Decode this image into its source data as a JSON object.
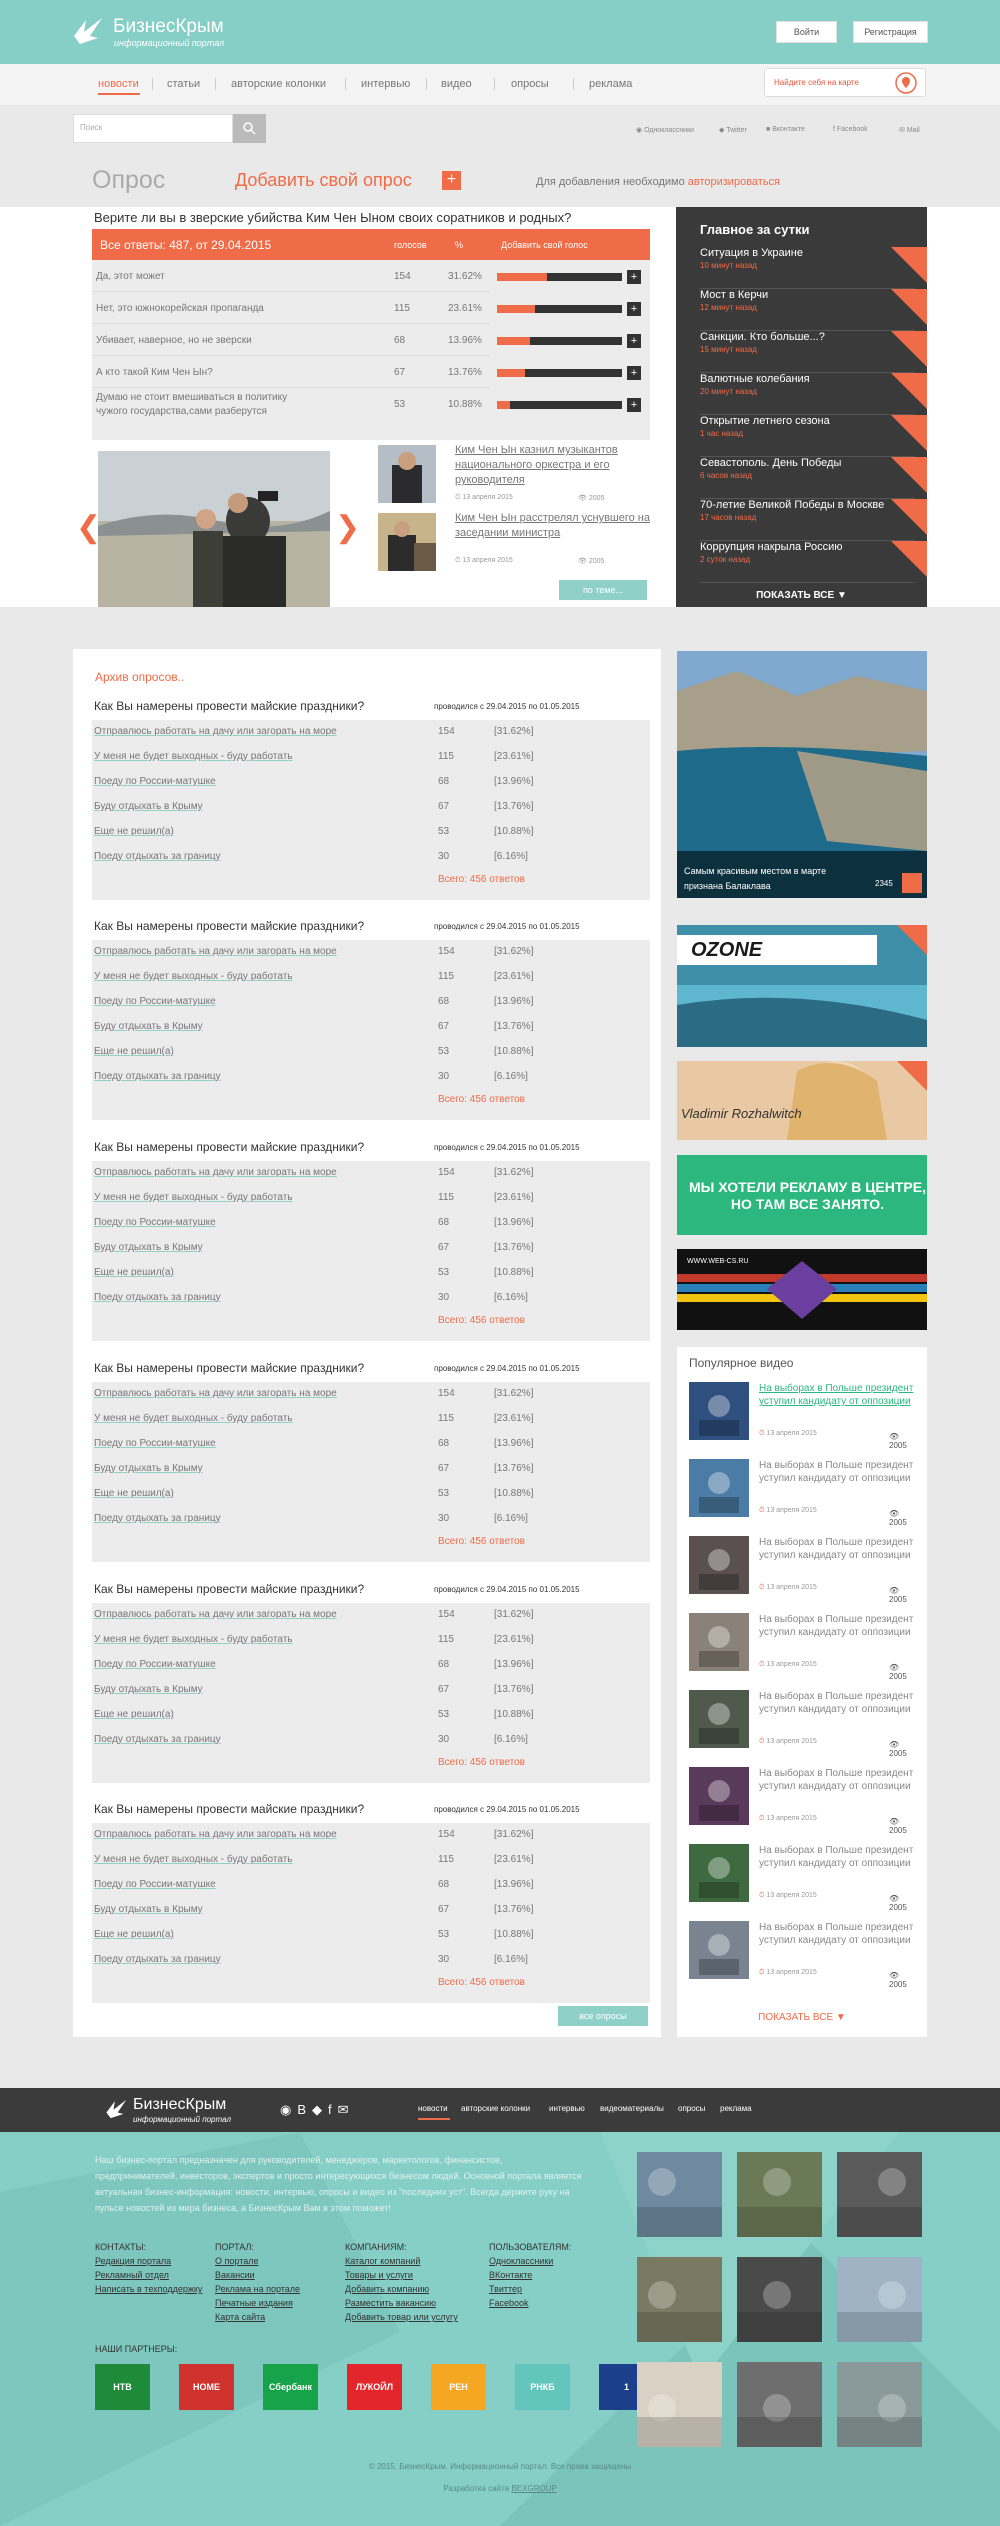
{
  "header": {
    "logo_title": "БизнесКрым",
    "logo_subtitle": "информационный портал",
    "login": "Войти",
    "register": "Регистрация"
  },
  "nav": {
    "items": [
      "новости",
      "статьи",
      "авторские колонки",
      "интервью",
      "видео",
      "опросы",
      "реклама"
    ],
    "find_on_map": "Найдите себя на карте"
  },
  "search": {
    "placeholder": "Поиск"
  },
  "social": [
    "Одноклассники",
    "Twitter",
    "Вконтакте",
    "Facebook",
    "Mail"
  ],
  "page": {
    "title": "Опрос",
    "add_poll": "Добавить свой опрос",
    "plus": "+",
    "note_prefix": "Для добавления необходимо ",
    "note_link": "авторизироваться"
  },
  "top_poll": {
    "question": "Верите ли вы в зверские убийства Ким Чен Ыном своих соратников и родных?",
    "all_answers": "Все ответы: 487, от 29.04.2015",
    "col_votes": "голосов",
    "col_pct": "%",
    "col_add": "Добавить свой голос",
    "rows": [
      {
        "text": "Да, этот может",
        "votes": "154",
        "pct": "31.62%",
        "frac": 0.4
      },
      {
        "text": "Нет, это южнокорейская пропаганда",
        "votes": "115",
        "pct": "23.61%",
        "frac": 0.3
      },
      {
        "text": "Убивает, наверное, но не зверски",
        "votes": "68",
        "pct": "13.96%",
        "frac": 0.26
      },
      {
        "text": "А кто такой Ким Чен Ын?",
        "votes": "67",
        "pct": "13.76%",
        "frac": 0.22
      },
      {
        "text": "Думаю не стоит вмешиваться в политику",
        "text2": "чужого государства,сами разберутся",
        "votes": "53",
        "pct": "10.88%",
        "frac": 0.1
      }
    ]
  },
  "top_news": {
    "title": "Главное за сутки",
    "show_all": "ПОКАЗАТЬ ВСЕ ▼",
    "items": [
      {
        "title": "Ситуация в Украине",
        "time": "10 минут назад"
      },
      {
        "title": "Мост в Керчи",
        "time": "12 минут назад"
      },
      {
        "title": "Санкции. Кто больше...?",
        "time": "15 минут назад"
      },
      {
        "title": "Валютные колебания",
        "time": "20 минут назад"
      },
      {
        "title": "Открытие летнего сезона",
        "time": "1 час назад"
      },
      {
        "title": "Севастополь. День Победы",
        "time": "6 часов назад"
      },
      {
        "title": "70-летие Великой Победы в Москве",
        "time": "17 часов назад"
      },
      {
        "title": "Коррупция накрыла Россию",
        "time": "2 суток назад"
      }
    ]
  },
  "side_news": [
    {
      "title": "Ким Чен Ын казнил музыкантов национального оркестра и его руководителя",
      "date": "13 апреля 2015",
      "views": "2005"
    },
    {
      "title": "Ким Чен Ын расстрелял уснувшего на заседании министра",
      "date": "13 апреля 2015",
      "views": "2005"
    }
  ],
  "more_themes": "по теме...",
  "archive": {
    "link": "Архив опросов..",
    "all_polls": "все опросы",
    "polls": [
      {
        "q": "Как Вы намерены провести майские праздники?",
        "dates": "проводился с 29.04.2015 по 01.05.2015",
        "total": "Всего: 456 ответов"
      },
      {
        "q": "Как Вы намерены провести майские праздники?",
        "dates": "проводился с 29.04.2015 по 01.05.2015",
        "total": "Всего: 456 ответов"
      },
      {
        "q": "Как Вы намерены провести майские праздники?",
        "dates": "проводился с 29.04.2015 по 01.05.2015",
        "total": "Всего: 456 ответов"
      },
      {
        "q": "Как Вы намерены провести майские праздники?",
        "dates": "проводился с 29.04.2015 по 01.05.2015",
        "total": "Всего: 456 ответов"
      },
      {
        "q": "Как Вы намерены провести майские праздники?",
        "dates": "проводился с 29.04.2015 по 01.05.2015",
        "total": "Всего: 456 ответов"
      },
      {
        "q": "Как Вы намерены провести майские праздники?",
        "dates": "проводился с 29.04.2015 по 01.05.2015",
        "total": "Всего: 456 ответов"
      }
    ],
    "answers": [
      {
        "t": "Отправлюсь работать на дачу или загорать на море",
        "n": "154",
        "p": "[31.62%]"
      },
      {
        "t": "У меня не будет выходных - буду работать",
        "n": "115",
        "p": "[23.61%]"
      },
      {
        "t": "Поеду по России-матушке",
        "n": "68",
        "p": "[13.96%]"
      },
      {
        "t": "Буду отдыхать в Крыму",
        "n": "67",
        "p": "[13.76%]"
      },
      {
        "t": "Еще не решил(а)",
        "n": "53",
        "p": "[10.88%]"
      },
      {
        "t": "Поеду отдыхать за границу",
        "n": "30",
        "p": "[6.16%]"
      }
    ]
  },
  "featured": {
    "caption1": "Самым красивым местом в марте",
    "caption2": "признана Балаклава",
    "views": "2345"
  },
  "ads": {
    "ozone": "OZONE",
    "photographer": "Vladimir Rozhalwitch",
    "text_ad": "МЫ ХОТЕЛИ РЕКЛАМУ В ЦЕНТРЕ, НО ТАМ ВСЕ ЗАНЯТО.",
    "web_url": "WWW.WEB-CS.RU"
  },
  "popular_video": {
    "title": "Популярное видео",
    "show_all": "ПОКАЗАТЬ ВСЕ ▼",
    "items": [
      {
        "t": "На выборах в Польше президент уступил кандидату от оппозиции",
        "d": "13 апреля 2015",
        "v": "2005"
      },
      {
        "t": "На выборах в Польше президент уступил кандидату от оппозиции",
        "d": "13 апреля 2015",
        "v": "2005"
      },
      {
        "t": "На выборах в Польше президент уступил кандидату от оппозиции",
        "d": "13 апреля 2015",
        "v": "2005"
      },
      {
        "t": "На выборах в Польше президент уступил кандидату от оппозиции",
        "d": "13 апреля 2015",
        "v": "2005"
      },
      {
        "t": "На выборах в Польше президент уступил кандидату от оппозиции",
        "d": "13 апреля 2015",
        "v": "2005"
      },
      {
        "t": "На выборах в Польше президент уступил кандидату от оппозиции",
        "d": "13 апреля 2015",
        "v": "2005"
      },
      {
        "t": "На выборах в Польше президент уступил кандидату от оппозиции",
        "d": "13 апреля 2015",
        "v": "2005"
      },
      {
        "t": "На выборах в Польше президент уступил кандидату от оппозиции",
        "d": "13 апреля 2015",
        "v": "2005"
      }
    ]
  },
  "footer": {
    "nav": [
      "новости",
      "авторские колонки",
      "интервью",
      "видеоматериалы",
      "опросы",
      "реклама"
    ],
    "description": "Наш бизнес-портал предназначен для руководителей, менеджеров, маркетологов, финансистов, предпринимателей, инвесторов, экспертов и просто интересующихся бизнесом людей. Основной портала является актуальная бизнес-информация: новости, интервью, опросы и видео из \"последних уст\". Всегда держите руку на пульсе новостей из мира бизнеса, а БизнесКрым Вам в этом поможет!",
    "cols": [
      {
        "h": "КОНТАКТЫ:",
        "items": [
          "Редакция портала",
          "Рекламный отдел",
          "Написать в техподдержку"
        ]
      },
      {
        "h": "ПОРТАЛ:",
        "items": [
          "О портале",
          "Вакансии",
          "Реклама на портале",
          "Печатные издания",
          "Карта сайта"
        ]
      },
      {
        "h": "КОМПАНИЯМ:",
        "items": [
          "Каталог компаний",
          "Товары и услуги",
          "Добавить компанию",
          "Разместить вакансию",
          "Добавить товар или услугу"
        ]
      },
      {
        "h": "ПОЛЬЗОВАТЕЛЯМ:",
        "items": [
          "Одноклассники",
          "ВКонтакте",
          "Твиттер",
          "Facebook"
        ]
      }
    ],
    "partners_h": "НАШИ ПАРТНЕРЫ:",
    "partners": [
      "НТВ",
      "HOME CREDIT BANK",
      "Сбербанк",
      "ЛУКОЙЛ",
      "РЕН",
      "РНКБ",
      "1"
    ],
    "copyright": "© 2015. БизнесКрым. Информационный портал. Все права защищены",
    "dev_prefix": "Разработка сайта ",
    "dev_link": "BEXGROUP"
  },
  "colors": {
    "accent": "#f06b47",
    "teal": "#86cfc6",
    "dark": "#3a3a3a"
  }
}
